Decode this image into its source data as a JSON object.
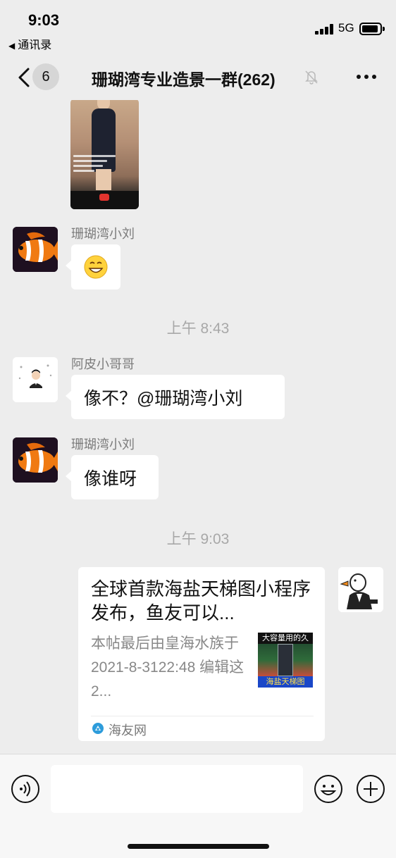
{
  "status_bar": {
    "time": "9:03",
    "back_app": "通讯录",
    "network": "5G"
  },
  "navbar": {
    "unread_count": "6",
    "title": "珊瑚湾专业造景一群(262)",
    "icons": [
      "chevron-left-icon",
      "mute-bell-icon",
      "more-icon"
    ]
  },
  "messages": [
    {
      "type": "video",
      "sender": "",
      "icon": "video-thumbnail"
    },
    {
      "type": "emoji",
      "sender": "珊瑚湾小刘",
      "avatar": "clownfish-avatar",
      "icon": "grinning-face-emoji"
    },
    {
      "type": "timestamp",
      "text": "上午 8:43"
    },
    {
      "type": "text",
      "sender": "阿皮小哥哥",
      "avatar": "man-cartoon-avatar",
      "text": "像不？@珊瑚湾小刘"
    },
    {
      "type": "text",
      "sender": "珊瑚湾小刘",
      "avatar": "clownfish-avatar",
      "text": "像谁呀"
    },
    {
      "type": "timestamp",
      "text": "上午 9:03"
    },
    {
      "type": "link_card",
      "avatar": "goose-avatar",
      "title": "全球首款海盐天梯图小程序发布，鱼友可以...",
      "description": "本帖最后由皇海水族于 2021-8-3122:48 编辑这 2...",
      "thumb_banner": "大容量用的久",
      "thumb_footer": "海盐天梯图",
      "source": "海友网"
    }
  ],
  "input_bar": {
    "placeholder": "",
    "icons": [
      "voice-icon",
      "emoji-icon",
      "plus-icon"
    ]
  },
  "colors": {
    "chat_background": "#ededed",
    "bubble": "#ffffff",
    "meta_text": "#a8a8a8",
    "card_description": "#888888"
  }
}
